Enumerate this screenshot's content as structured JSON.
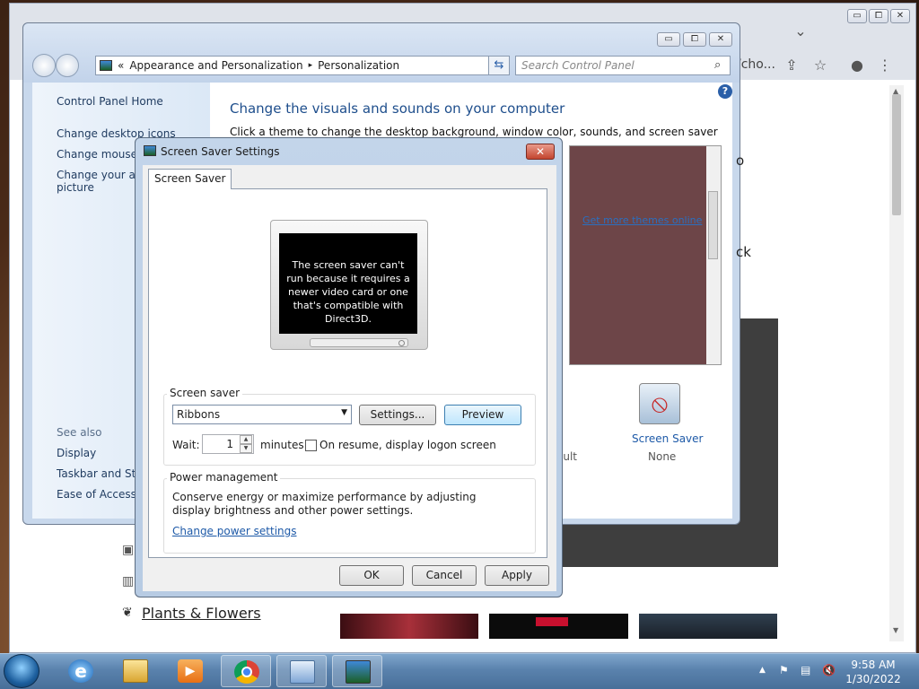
{
  "chrome": {
    "url_fragment": "/cho...",
    "plants_link": "Plants & Flowers",
    "win_buttons": [
      "▭",
      "⧠",
      "✕"
    ]
  },
  "control_panel": {
    "breadcrumb_prefix": "«",
    "breadcrumb_1": "Appearance and Personalization",
    "breadcrumb_sep": "▸",
    "breadcrumb_2": "Personalization",
    "search_placeholder": "Search Control Panel",
    "left_links": [
      "Control Panel Home",
      "Change desktop icons",
      "Change mouse pointers",
      "Change your account picture"
    ],
    "see_also_label": "See also",
    "see_also_links": [
      "Display",
      "Taskbar and Start Menu",
      "Ease of Access Center"
    ],
    "title": "Change the visuals and sounds on your computer",
    "subtitle": "Click a theme to change the desktop background, window color, sounds, and screen saver all at once.",
    "theme_link": "Get more themes online",
    "theme_letters": [
      "o",
      "ck"
    ],
    "screen_saver_label": "Screen Saver",
    "screen_saver_value": "None",
    "default_fragment": "ault"
  },
  "dialog": {
    "title": "Screen Saver Settings",
    "close": "✕",
    "tab": "Screen Saver",
    "preview_message": "The screen saver can't run because it requires a newer video card or one that's compatible with Direct3D.",
    "group_screen_saver": "Screen saver",
    "selected_saver": "Ribbons",
    "settings_button": "Settings...",
    "preview_button": "Preview",
    "wait_label": "Wait:",
    "wait_value": "1",
    "minutes_label": "minutes",
    "resume_label": "On resume, display logon screen",
    "resume_checked": false,
    "group_power": "Power management",
    "power_text": "Conserve energy or maximize performance by adjusting display brightness and other power settings.",
    "power_link": "Change power settings",
    "ok": "OK",
    "cancel": "Cancel",
    "apply": "Apply"
  },
  "taskbar": {
    "time": "9:58 AM",
    "date": "1/30/2022"
  }
}
